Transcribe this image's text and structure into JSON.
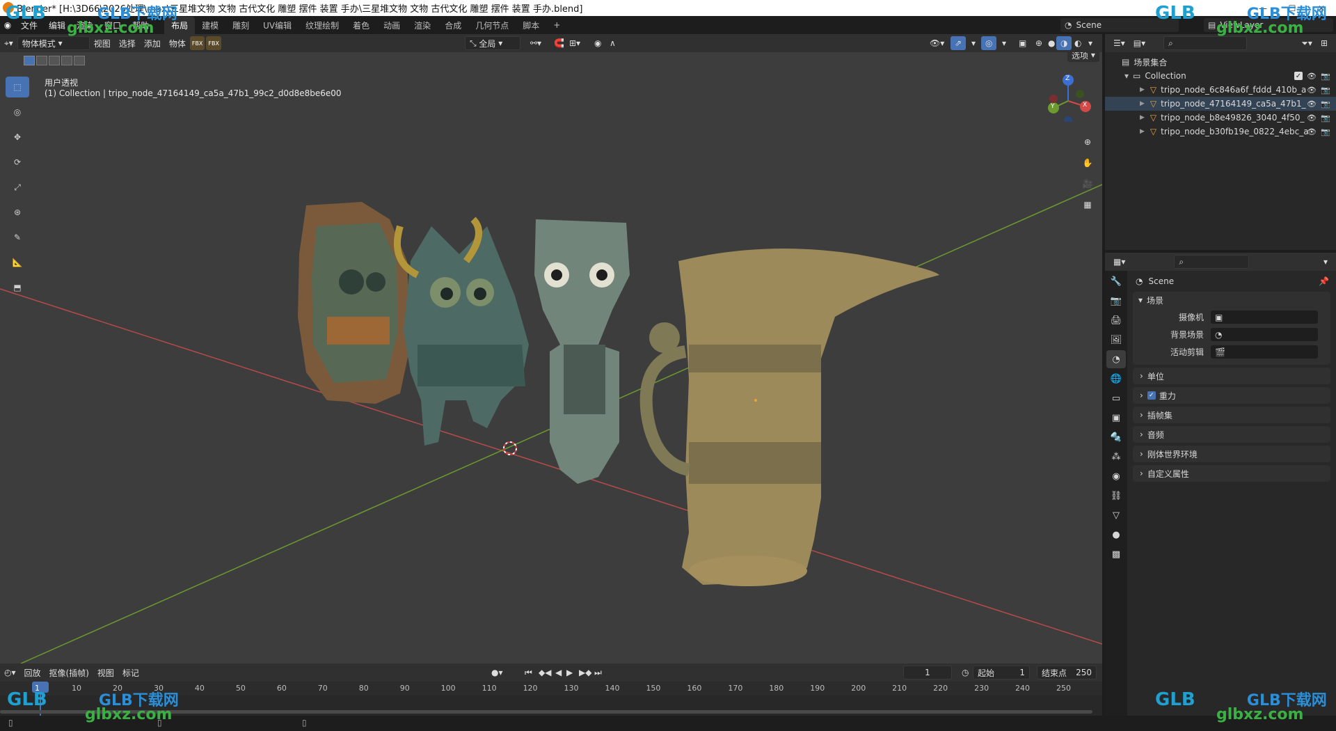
{
  "titlebar": {
    "title": "Blender* [H:\\3D66\\2026处理\\max\\三星堆文物 文物 古代文化 雕塑 摆件 装置 手办\\三星堆文物 文物 古代文化 雕塑 摆件 装置 手办.blend]"
  },
  "topbar": {
    "menus": [
      "文件",
      "编辑",
      "渲染",
      "窗口",
      "帮助"
    ],
    "workspaces": [
      "布局",
      "建模",
      "雕刻",
      "UV编辑",
      "纹理绘制",
      "着色",
      "动画",
      "渲染",
      "合成",
      "几何节点",
      "脚本"
    ],
    "add_tab": "+",
    "scene": "Scene",
    "view_layer": "ViewLayer"
  },
  "viewport_header": {
    "mode": "物体模式",
    "menus": [
      "视图",
      "选择",
      "添加",
      "物体"
    ],
    "fbx_icon_label": "FBX",
    "transform_orientation": "全局",
    "options": "选项"
  },
  "viewport": {
    "view_name": "用户透视",
    "collection_info": "(1) Collection | tripo_node_47164149_ca5a_47b1_99c2_d0d8e8be6e00",
    "gizmo": {
      "z": "Z",
      "y": "Y",
      "x": "X"
    }
  },
  "timeline": {
    "menus": [
      "回放",
      "抠像(插帧)",
      "视图",
      "标记"
    ],
    "current_frame": "1",
    "start_label": "起始",
    "start_value": "1",
    "end_label": "结束点",
    "end_value": "250",
    "ruler": [
      "1",
      "10",
      "20",
      "30",
      "40",
      "50",
      "60",
      "70",
      "80",
      "90",
      "100",
      "110",
      "120",
      "130",
      "140",
      "150",
      "160",
      "170",
      "180",
      "190",
      "200",
      "210",
      "220",
      "230",
      "240",
      "250"
    ]
  },
  "outliner": {
    "scene_collection": "场景集合",
    "collection": "Collection",
    "items": [
      "tripo_node_6c846a6f_fddd_410b_a",
      "tripo_node_47164149_ca5a_47b1_",
      "tripo_node_b8e49826_3040_4f50_",
      "tripo_node_b30fb19e_0822_4ebc_a"
    ]
  },
  "properties": {
    "context": "Scene",
    "section_scene": "场景",
    "camera_label": "摄像机",
    "background_label": "背景场景",
    "clip_label": "活动剪辑",
    "panels": [
      "单位",
      "重力",
      "插帧集",
      "音频",
      "刚体世界环境",
      "自定义属性"
    ],
    "gravity_checked": true
  },
  "watermarks": {
    "brand": "GLB下载网",
    "url": "glbxz.com",
    "logo": "GLB"
  },
  "colors": {
    "accent": "#4772b3",
    "x_axis": "#b84a4a",
    "y_axis": "#6c9a2f",
    "z_axis": "#3c6fd4",
    "object_icon": "#e8a33d"
  }
}
